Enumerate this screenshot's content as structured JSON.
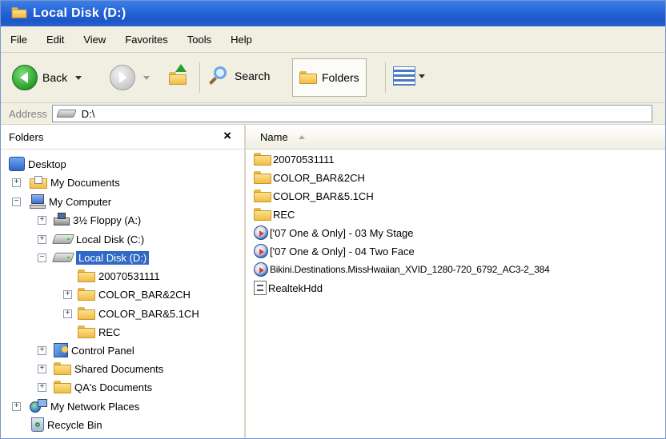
{
  "window": {
    "title": "Local Disk (D:)"
  },
  "menu": [
    "File",
    "Edit",
    "View",
    "Favorites",
    "Tools",
    "Help"
  ],
  "toolbar": {
    "back": "Back",
    "search": "Search",
    "folders": "Folders"
  },
  "address": {
    "label": "Address",
    "value": "D:\\"
  },
  "folders_pane": {
    "title": "Folders",
    "close": "×",
    "tree": [
      {
        "label": "Desktop",
        "icon": "desktop-icon",
        "level": 0,
        "expander": ""
      },
      {
        "label": "My Documents",
        "icon": "documents-icon",
        "level": 1,
        "expander": "+"
      },
      {
        "label": "My Computer",
        "icon": "computer-icon",
        "level": 1,
        "expander": "−"
      },
      {
        "label": "3½ Floppy (A:)",
        "icon": "floppy-icon",
        "level": 2,
        "expander": "+"
      },
      {
        "label": "Local Disk (C:)",
        "icon": "drive-icon",
        "level": 2,
        "expander": "+"
      },
      {
        "label": "Local Disk (D:)",
        "icon": "drive-icon",
        "level": 2,
        "expander": "−",
        "selected": true
      },
      {
        "label": "20070531111",
        "icon": "folder-icon",
        "level": 3,
        "expander": ""
      },
      {
        "label": "COLOR_BAR&2CH",
        "icon": "folder-icon",
        "level": 3,
        "expander": "+"
      },
      {
        "label": "COLOR_BAR&5.1CH",
        "icon": "folder-icon",
        "level": 3,
        "expander": "+"
      },
      {
        "label": "REC",
        "icon": "folder-icon",
        "level": 3,
        "expander": ""
      },
      {
        "label": "Control Panel",
        "icon": "control-panel-icon",
        "level": 2,
        "expander": "+"
      },
      {
        "label": "Shared Documents",
        "icon": "folder-icon",
        "level": 2,
        "expander": "+"
      },
      {
        "label": "QA's Documents",
        "icon": "folder-icon",
        "level": 2,
        "expander": "+"
      },
      {
        "label": "My Network Places",
        "icon": "network-icon",
        "level": 1,
        "expander": "+"
      },
      {
        "label": "Recycle Bin",
        "icon": "recycle-bin-icon",
        "level": 1,
        "expander": ""
      }
    ]
  },
  "file_list": {
    "column": "Name",
    "items": [
      {
        "name": "20070531111",
        "icon": "folder-icon"
      },
      {
        "name": "COLOR_BAR&2CH",
        "icon": "folder-icon"
      },
      {
        "name": "COLOR_BAR&5.1CH",
        "icon": "folder-icon"
      },
      {
        "name": "REC",
        "icon": "folder-icon"
      },
      {
        "name": "['07 One & Only] - 03 My Stage",
        "icon": "media-file-icon"
      },
      {
        "name": "['07 One & Only] - 04 Two Face",
        "icon": "media-file-icon"
      },
      {
        "name": "Bikini.Destinations.MissHwaiian_XVID_1280-720_6792_AC3-2_384",
        "icon": "media-file-icon"
      },
      {
        "name": "RealtekHdd",
        "icon": "text-file-icon"
      }
    ]
  }
}
